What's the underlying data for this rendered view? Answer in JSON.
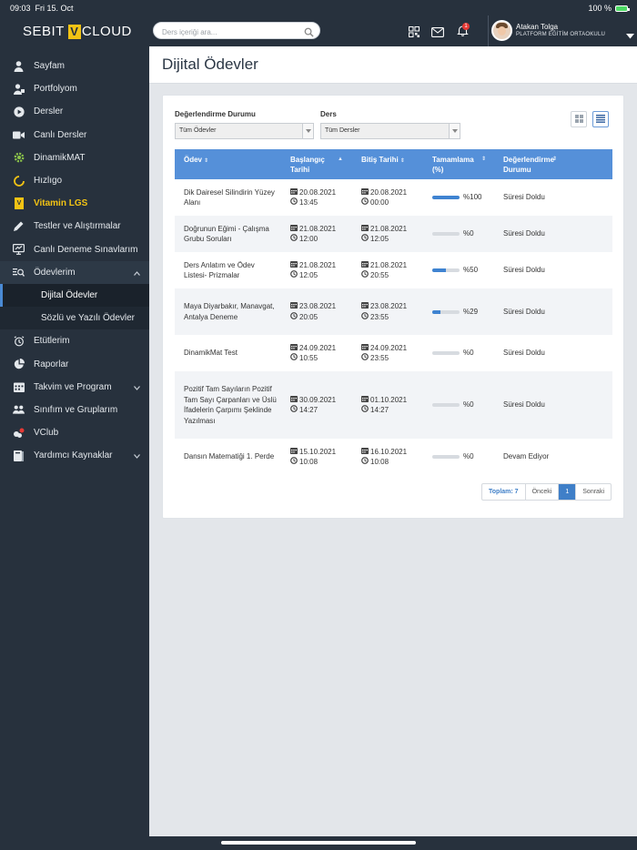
{
  "status_bar": {
    "time": "09:03",
    "date": "Fri 15. Oct",
    "battery": "100 %"
  },
  "header": {
    "logo_left": "SEBIT",
    "logo_v": "V",
    "logo_right": "CLOUD",
    "search_placeholder": "Ders içeriği ara...",
    "notification_count": "1",
    "user_name": "Atakan Tolga",
    "user_school": "PLATFORM EĞİTİM ORTAOKULU"
  },
  "sidebar": {
    "items": [
      {
        "label": "Sayfam",
        "icon": "user-icon"
      },
      {
        "label": "Portfolyom",
        "icon": "portfolio-user-icon"
      },
      {
        "label": "Dersler",
        "icon": "play-circle-icon"
      },
      {
        "label": "Canlı Dersler",
        "icon": "video-camera-icon"
      },
      {
        "label": "DinamikMAT",
        "icon": "gear-icon"
      },
      {
        "label": "Hızlıgo",
        "icon": "hizligo-icon"
      },
      {
        "label": "Vitamin LGS",
        "icon": "vitamin-lgs-icon"
      },
      {
        "label": "Testler ve Alıştırmalar",
        "icon": "pencil-icon"
      },
      {
        "label": "Canlı Deneme Sınavlarım",
        "icon": "monitor-icon"
      },
      {
        "label": "Ödevlerim",
        "icon": "homework-search-icon"
      },
      {
        "label": "Dijital Ödevler",
        "icon": ""
      },
      {
        "label": "Sözlü ve Yazılı Ödevler",
        "icon": ""
      },
      {
        "label": "Etütlerim",
        "icon": "alarm-clock-icon"
      },
      {
        "label": "Raporlar",
        "icon": "pie-chart-icon"
      },
      {
        "label": "Takvim ve Program",
        "icon": "calendar-icon"
      },
      {
        "label": "Sınıfım ve Gruplarım",
        "icon": "users-icon"
      },
      {
        "label": "VClub",
        "icon": "vclub-icon"
      },
      {
        "label": "Yardımcı Kaynaklar",
        "icon": "book-icon"
      }
    ]
  },
  "page": {
    "title": "Dijital Ödevler"
  },
  "filters": {
    "status_label": "Değerlendirme Durumu",
    "status_value": "Tüm Ödevler",
    "course_label": "Ders",
    "course_value": "Tüm Dersler"
  },
  "table": {
    "columns": [
      "Ödev",
      "Başlangıç Tarihi",
      "Bitiş Tarihi",
      "Tamamlama (%)",
      "Değerlendirme Durumu"
    ],
    "rows": [
      {
        "name": "Dik Dairesel Silindirin Yüzey Alanı",
        "start_date": "20.08.2021",
        "start_time": "13:45",
        "end_date": "20.08.2021",
        "end_time": "00:00",
        "completion": 100,
        "completion_text": "%100",
        "status": "Süresi Doldu"
      },
      {
        "name": "Doğrunun Eğimi - Çalışma Grubu Soruları",
        "start_date": "21.08.2021",
        "start_time": "12:00",
        "end_date": "21.08.2021",
        "end_time": "12:05",
        "completion": 0,
        "completion_text": "%0",
        "status": "Süresi Doldu"
      },
      {
        "name": "Ders Anlatım ve Ödev Listesi- Prizmalar",
        "start_date": "21.08.2021",
        "start_time": "12:05",
        "end_date": "21.08.2021",
        "end_time": "20:55",
        "completion": 50,
        "completion_text": "%50",
        "status": "Süresi Doldu"
      },
      {
        "name": "Maya Diyarbakır, Manavgat, Antalya Deneme",
        "start_date": "23.08.2021",
        "start_time": "20:05",
        "end_date": "23.08.2021",
        "end_time": "23:55",
        "completion": 29,
        "completion_text": "%29",
        "status": "Süresi Doldu"
      },
      {
        "name": "DinamikMat Test",
        "start_date": "24.09.2021",
        "start_time": "10:55",
        "end_date": "24.09.2021",
        "end_time": "23:55",
        "completion": 0,
        "completion_text": "%0",
        "status": "Süresi Doldu"
      },
      {
        "name": "Pozitif Tam Sayıların Pozitif Tam Sayı Çarpanları ve Üslü İfadelerin Çarpımı Şeklinde Yazılması",
        "start_date": "30.09.2021",
        "start_time": "14:27",
        "end_date": "01.10.2021",
        "end_time": "14:27",
        "completion": 0,
        "completion_text": "%0",
        "status": "Süresi Doldu"
      },
      {
        "name": "Dansın Matematiği 1. Perde",
        "start_date": "15.10.2021",
        "start_time": "10:08",
        "end_date": "16.10.2021",
        "end_time": "10:08",
        "completion": 0,
        "completion_text": "%0",
        "status": "Devam Ediyor"
      }
    ]
  },
  "pagination": {
    "total": "Toplam: 7",
    "prev": "Önceki",
    "current": "1",
    "next": "Sonraki"
  },
  "colors": {
    "sidebar_bg": "#27313d",
    "table_header": "#5590d9",
    "progress": "#3f83d1",
    "lgs_accent": "#f2c314"
  }
}
